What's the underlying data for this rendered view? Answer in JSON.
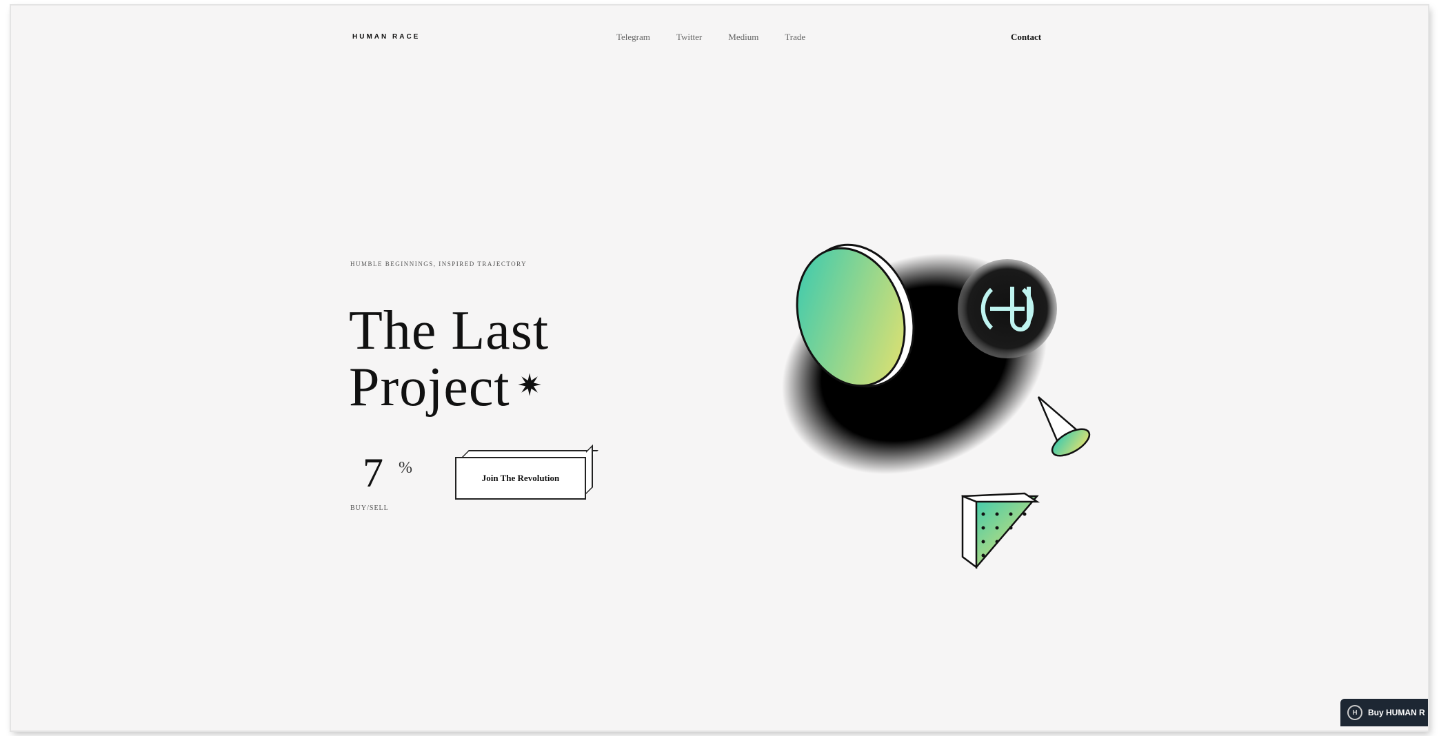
{
  "header": {
    "brand": "HUMAN RACE",
    "nav": [
      "Telegram",
      "Twitter",
      "Medium",
      "Trade"
    ],
    "contact": "Contact"
  },
  "hero": {
    "eyebrow": "HUMBLE BEGINNINGS, INSPIRED TRAJECTORY",
    "title_line1": "The Last",
    "title_line2": "Project",
    "asterisk": "✷",
    "stat_value": "7",
    "stat_unit": "%",
    "stat_label": "BUY/SELL",
    "cta": "Join The Revolution"
  },
  "widget": {
    "label": "Buy HUMAN R",
    "icon": "coin-logo-icon"
  },
  "colors": {
    "background": "#f6f5f5",
    "gradient_teal": "#2ec8b4",
    "gradient_yellow": "#f0e36a",
    "widget_bg": "#1d2733"
  }
}
